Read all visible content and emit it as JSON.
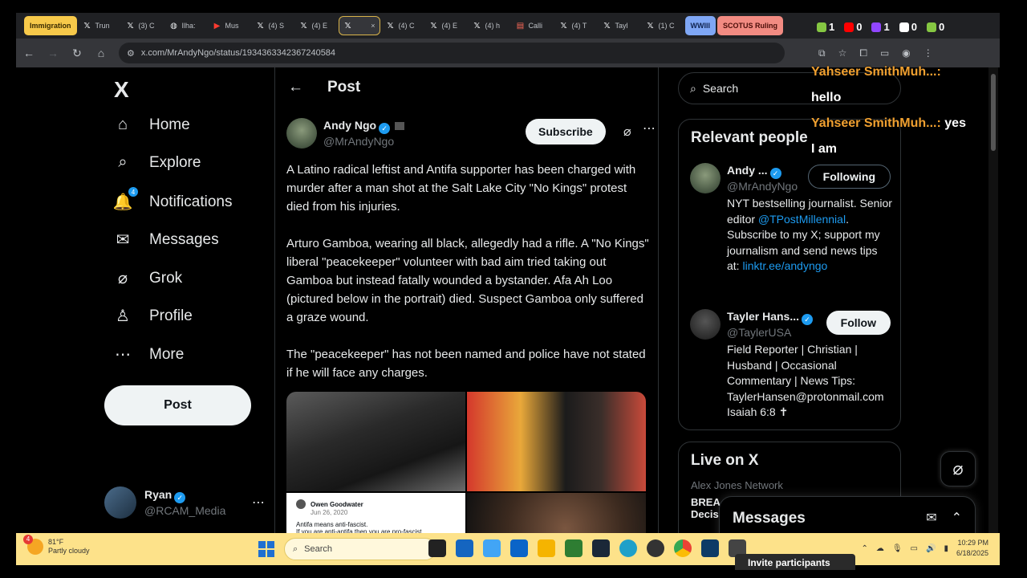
{
  "browser": {
    "tabs": [
      {
        "label": "Immigration",
        "kind": "group-yellow"
      },
      {
        "label": "Trun",
        "icon": "x"
      },
      {
        "label": "(3) C",
        "icon": "x"
      },
      {
        "label": "Ilha:",
        "icon": "globe"
      },
      {
        "label": "Mus",
        "icon": "youtube"
      },
      {
        "label": "(4) S",
        "icon": "x"
      },
      {
        "label": "(4) E",
        "icon": "x"
      },
      {
        "label": "",
        "icon": "x",
        "active": true
      },
      {
        "label": "(4) C",
        "icon": "x"
      },
      {
        "label": "(4) E",
        "icon": "x"
      },
      {
        "label": "(4) h",
        "icon": "x"
      },
      {
        "label": "Calli",
        "icon": "doc"
      },
      {
        "label": "(4) T",
        "icon": "x"
      },
      {
        "label": "Tayl",
        "icon": "x"
      },
      {
        "label": "(1) C",
        "icon": "x"
      },
      {
        "label": "WWIII",
        "kind": "group-blue"
      },
      {
        "label": "SCOTUS Ruling",
        "kind": "group-red"
      }
    ],
    "url": "x.com/MrAndyNgo/status/1934363342367240584"
  },
  "nav": {
    "logo": "X",
    "items": [
      {
        "label": "Home",
        "icon": "⌂",
        "name": "home"
      },
      {
        "label": "Explore",
        "icon": "⌕",
        "name": "explore"
      },
      {
        "label": "Notifications",
        "icon": "🔔",
        "name": "notifications",
        "badge": "4"
      },
      {
        "label": "Messages",
        "icon": "✉",
        "name": "messages"
      },
      {
        "label": "Grok",
        "icon": "⌀",
        "name": "grok"
      },
      {
        "label": "Profile",
        "icon": "♙",
        "name": "profile"
      },
      {
        "label": "More",
        "icon": "⋯",
        "name": "more"
      }
    ],
    "post_label": "Post",
    "account": {
      "name": "Ryan",
      "handle": "@RCAM_Media"
    }
  },
  "main": {
    "header": "Post",
    "author": {
      "name": "Andy Ngo",
      "handle": "@MrAndyNgo"
    },
    "subscribe_label": "Subscribe",
    "paragraphs": [
      "A Latino radical leftist and Antifa supporter has been charged with murder after a man shot at the Salt Lake City \"No Kings\" protest died from his injuries.",
      "Arturo Gamboa, wearing all black, allegedly had a rifle. A \"No Kings\" liberal \"peacekeeper\" volunteer with bad aim tried taking out Gamboa but instead fatally wounded a bystander. Afa Ah Loo (pictured below in the portrait) died. Suspect Gamboa only suffered a graze wound.",
      "The \"peacekeeper\" has not been named and police have not stated if he will face any charges."
    ],
    "media_quote": {
      "name": "Owen Goodwater",
      "date": "Jun 26, 2020",
      "line1": "Antifa means anti-fascist.",
      "line2": "If you are anti-antifa then you are pro-fascist"
    }
  },
  "right": {
    "search_placeholder": "Search",
    "relevant_title": "Relevant people",
    "people": [
      {
        "name": "Andy ...",
        "handle": "@MrAndyNgo",
        "button": "Following",
        "bio_a": "NYT bestselling journalist. Senior editor ",
        "bio_link": "@TPostMillennial",
        "bio_b": ". Subscribe to my X; support my journalism and send news tips at: ",
        "bio_link2": "linktr.ee/andyngo"
      },
      {
        "name": "Tayler Hans...",
        "handle": "@TaylerUSA",
        "button": "Follow",
        "bio_a": "Field Reporter | Christian | Husband | Occasional Commentary | News Tips: TaylerHansen@protonmail.com Isaiah 6:8 ✝"
      }
    ],
    "live_title": "Live on X",
    "live_host": "Alex Jones Network",
    "live_sub": "BREA",
    "live_sub2": "Decis"
  },
  "messages_drawer": {
    "label": "Messages"
  },
  "chat_overlay": [
    {
      "type": "name",
      "text": "Yahseer SmithMuh...:"
    },
    {
      "type": "msg",
      "text": "hello"
    },
    {
      "type": "name",
      "text": "Yahseer SmithMuh...:",
      "suffix": "yes"
    },
    {
      "type": "msg",
      "text": "I am"
    }
  ],
  "stream_stats": [
    {
      "icon": "rumble",
      "value": "1",
      "color": "#85c742"
    },
    {
      "icon": "youtube",
      "value": "0",
      "color": "#ff0000"
    },
    {
      "icon": "twitch",
      "value": "1",
      "color": "#9146ff"
    },
    {
      "icon": "x",
      "value": "0",
      "color": "#ffffff"
    },
    {
      "icon": "link",
      "value": "0",
      "color": "#85c742"
    }
  ],
  "taskbar": {
    "weather_temp": "81°F",
    "weather_desc": "Partly cloudy",
    "weather_badge": "4",
    "search_label": "Search",
    "time": "10:29 PM",
    "date": "6/18/2025"
  },
  "invite_label": "Invite participants"
}
